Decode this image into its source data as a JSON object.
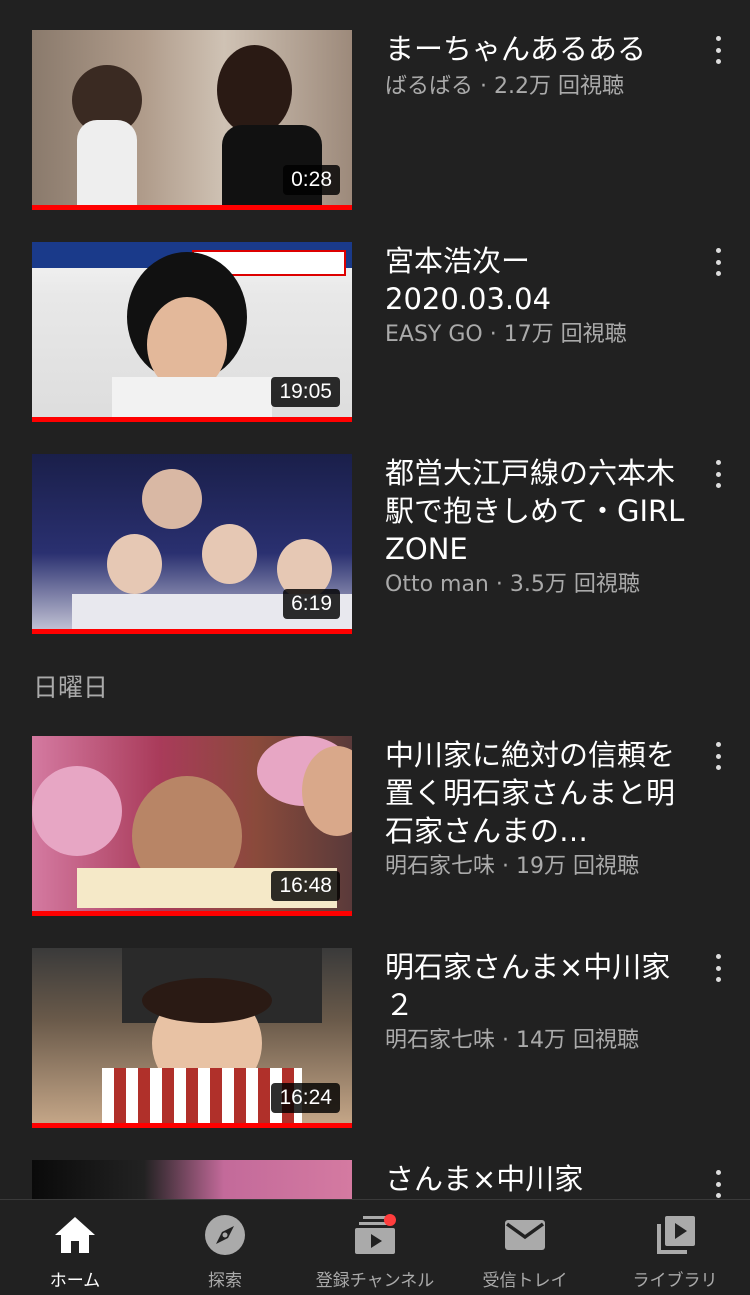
{
  "section_header": "日曜日",
  "videos": [
    {
      "title": "まーちゃんあるある",
      "meta": "ばるばる · 2.2万 回視聴",
      "duration": "0:28"
    },
    {
      "title": "宮本浩次ー\n2020.03.04",
      "meta": "EASY GO · 17万 回視聴",
      "duration": "19:05"
    },
    {
      "title": "都営大江戸線の六本木駅で抱きしめて・GIRL ZONE",
      "meta": "Otto man · 3.5万 回視聴",
      "duration": "6:19"
    },
    {
      "title": "中川家に絶対の信頼を置く明石家さんまと明石家さんまの…",
      "meta": "明石家七味 · 19万 回視聴",
      "duration": "16:48"
    },
    {
      "title": "明石家さんま×中川家２",
      "meta": "明石家七味 · 14万 回視聴",
      "duration": "16:24"
    },
    {
      "title": "さんま×中川家",
      "meta": "",
      "duration": ""
    }
  ],
  "nav": [
    {
      "label": "ホーム",
      "icon": "home-icon"
    },
    {
      "label": "探索",
      "icon": "compass-icon"
    },
    {
      "label": "登録チャンネル",
      "icon": "subscriptions-icon"
    },
    {
      "label": "受信トレイ",
      "icon": "mail-icon"
    },
    {
      "label": "ライブラリ",
      "icon": "library-icon"
    }
  ],
  "colors": {
    "background": "#212121",
    "progress": "#ff0000",
    "secondary_text": "#aaaaaa",
    "badge": "#ff3d3d"
  }
}
